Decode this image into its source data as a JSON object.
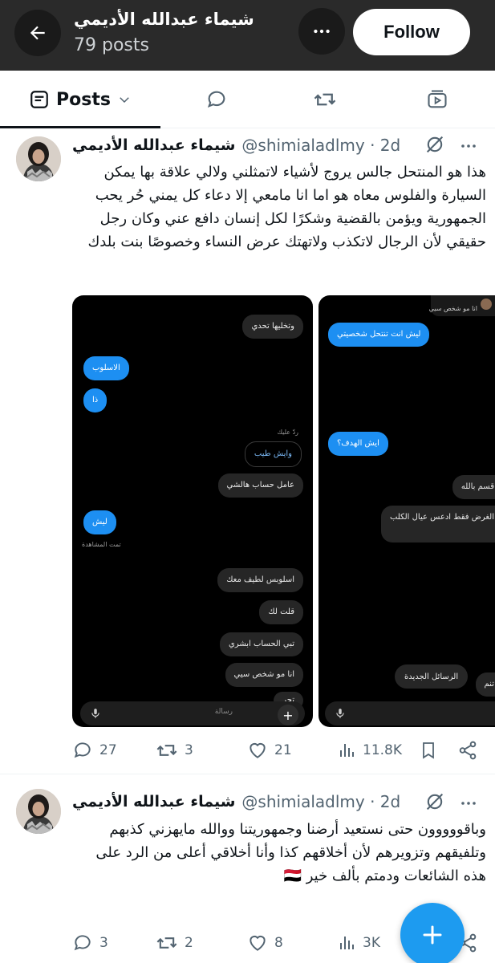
{
  "header": {
    "title": "شيماء عبدالله الأديمي",
    "posts_count": "79 posts",
    "follow_label": "Follow"
  },
  "tabs": {
    "posts_label": "Posts"
  },
  "tweets": [
    {
      "name": "شيماء عبدالله الأديمي",
      "handle": "@shimialadlmy · 2d",
      "text": "هذا هو المنتحل جالس يروج لأشياء لاتمثلني ولالي علاقة بها يمكن السيارة والفلوس معاه هو اما انا مامعي إلا دعاء كل يمني حُر يحب الجمهورية ويؤمن بالقضية وشكرًا لكل إنسان دافع عني وكان رجل حقيقي لأن الرجال لاتكذب ولاتهتك عرض النساء وخصوصًا بنت بلدك",
      "media": {
        "left": {
          "bubbles": [
            "وتخليها تحدي",
            "الاسلوب",
            "ذا",
            "وايش طيب",
            "عامل حساب هالشي",
            "ليش",
            "اسلوبس لطيف معك",
            "قلت لك",
            "تبي الحساب ابشري",
            "انا مو شخص سيي",
            "تجر"
          ],
          "reply_label": "ردّ عليك",
          "seen_label": "تمت المشاهدة",
          "composer_placeholder": "رسالة"
        },
        "right": {
          "bubbles": [
            "انا مو شخص سيي",
            "ليش انت تنتحل شخصيتي",
            "ايش الهدف؟",
            "قسم بالله",
            "الغرض فقط ادعس عيال الكلب",
            "تنم"
          ],
          "new_messages_label": "الرسائل الجديدة"
        }
      },
      "stats": {
        "replies": "27",
        "reposts": "3",
        "likes": "21",
        "views": "11.8K"
      }
    },
    {
      "name": "شيماء عبدالله الأديمي",
      "handle": "@shimialadlmy · 2d",
      "text": "وباقووووون حتى نستعيد أرضنا وجمهوريتنا ووالله مايهزني كذبهم وتلفيقهم وتزويرهم لأن أخلاقهم كذا وأنا أخلاقي أعلى من الرد على هذه الشائعات ودمتم بألف خير 🇾🇪",
      "stats": {
        "replies": "3",
        "reposts": "2",
        "likes": "8",
        "views": "3K"
      }
    }
  ],
  "colors": {
    "header_bg": "#2a2a2a",
    "accent": "#1d9bf0",
    "muted_text": "#536471"
  },
  "icons": [
    "back-arrow-icon",
    "more-icon",
    "posts-tab-icon",
    "chevron-down-icon",
    "reply-icon",
    "repost-icon",
    "media-icon",
    "grok-icon",
    "like-icon",
    "views-icon",
    "bookmark-icon",
    "share-icon",
    "plus-icon"
  ]
}
